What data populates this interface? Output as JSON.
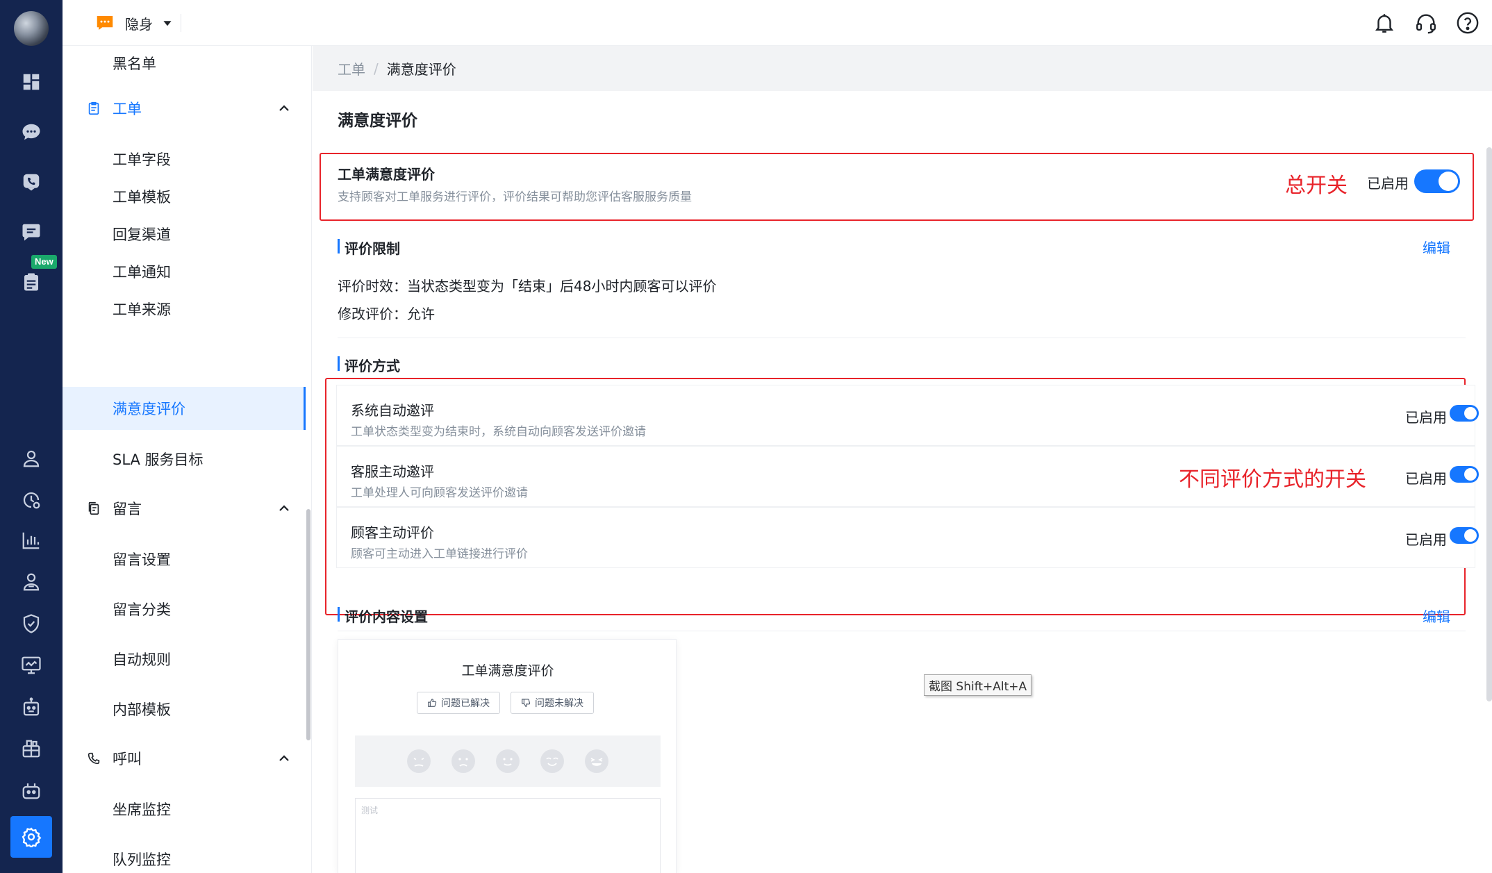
{
  "header": {
    "status_label": "隐身",
    "icons": [
      "bell-icon",
      "headset-icon",
      "help-icon"
    ]
  },
  "rail": {
    "new_badge": "New",
    "icons": [
      "dashboard-icon",
      "chat-icon",
      "phone-icon",
      "message-icon",
      "ticket-icon",
      "user-icon",
      "clock-icon",
      "bar-chart-icon",
      "users-icon",
      "shield-icon",
      "monitor-icon",
      "robot-icon",
      "integration-icon",
      "bot-icon",
      "settings-icon"
    ]
  },
  "sidebar": {
    "top_item": "黑名单",
    "groups": [
      {
        "label": "工单",
        "items": [
          "工单字段",
          "工单模板",
          "回复渠道",
          "工单通知",
          "工单来源",
          "满意度评价",
          "SLA 服务目标"
        ]
      },
      {
        "label": "留言",
        "items": [
          "留言设置",
          "留言分类",
          "自动规则",
          "内部模板"
        ]
      },
      {
        "label": "呼叫",
        "items": [
          "坐席监控",
          "队列监控"
        ]
      }
    ],
    "active_item": "满意度评价"
  },
  "breadcrumb": {
    "parent": "工单",
    "separator": "/",
    "current": "满意度评价"
  },
  "page": {
    "title": "满意度评价",
    "master_switch": {
      "title": "工单满意度评价",
      "description": "支持顾客对工单服务进行评价，评价结果可帮助您评估客服服务质量",
      "status_label": "已启用",
      "enabled": true,
      "annotation": "总开关"
    },
    "limits": {
      "heading": "评价限制",
      "edit_label": "编辑",
      "validity": "评价时效：当状态类型变为「结束」后48小时内顾客可以评价",
      "modify": "修改评价：允许"
    },
    "methods": {
      "heading": "评价方式",
      "annotation": "不同评价方式的开关",
      "items": [
        {
          "title": "系统自动邀评",
          "description": "工单状态类型变为结束时，系统自动向顾客发送评价邀请",
          "status_label": "已启用",
          "enabled": true
        },
        {
          "title": "客服主动邀评",
          "description": "工单处理人可向顾客发送评价邀请",
          "status_label": "已启用",
          "enabled": true
        },
        {
          "title": "顾客主动评价",
          "description": "顾客可主动进入工单链接进行评价",
          "status_label": "已启用",
          "enabled": true
        }
      ]
    },
    "content_settings": {
      "heading": "评价内容设置",
      "edit_label": "编辑",
      "tooltip": "截图 Shift+Alt+A",
      "preview": {
        "title": "工单满意度评价",
        "resolved_label": "问题已解决",
        "unresolved_label": "问题未解决",
        "faces": [
          "very-unsatisfied-face-icon",
          "unsatisfied-face-icon",
          "neutral-face-icon",
          "satisfied-face-icon",
          "very-satisfied-face-icon"
        ],
        "textarea_placeholder": "测试"
      }
    }
  },
  "colors": {
    "accent": "#1677ff",
    "rail_bg": "#14254f",
    "annotation": "#e8232a",
    "new_badge": "#1aa96b"
  }
}
